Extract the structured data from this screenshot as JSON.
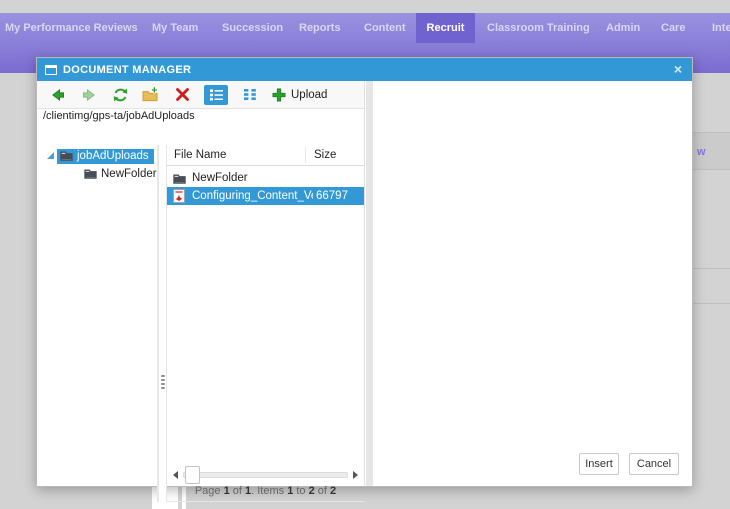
{
  "nav": {
    "items": [
      {
        "label": "My Performance Reviews",
        "active": false
      },
      {
        "label": "My Team",
        "active": false
      },
      {
        "label": "Succession",
        "active": false
      },
      {
        "label": "Reports",
        "active": false
      },
      {
        "label": "Content",
        "active": false
      },
      {
        "label": "Recruit",
        "active": true
      },
      {
        "label": "Classroom Training",
        "active": false
      },
      {
        "label": "Admin",
        "active": false
      },
      {
        "label": "Care",
        "active": false
      },
      {
        "label": "Inte",
        "active": false
      }
    ]
  },
  "page_background": {
    "truncated_link_text": "w"
  },
  "dialog": {
    "title": "DOCUMENT MANAGER",
    "icons": {
      "window": "window-icon",
      "close": "close-icon",
      "back": "back-arrow-icon",
      "forward": "forward-arrow-icon",
      "refresh": "refresh-icon",
      "new_folder": "new-folder-icon",
      "delete": "delete-icon",
      "list_view": "list-view-icon",
      "grid_view": "grid-view-icon",
      "upload": "upload-plus-icon",
      "folder": "folder-icon",
      "pdf": "pdf-file-icon"
    },
    "toolbar": {
      "upload_label": "Upload",
      "view_mode": "list"
    },
    "path_bar": {
      "value": "/clientimg/gps-ta/jobAdUploads"
    },
    "tree": {
      "items": [
        {
          "label": "jobAdUploads",
          "selected": true,
          "expanded": true
        },
        {
          "label": "NewFolder",
          "selected": false,
          "expanded": false
        }
      ]
    },
    "files": {
      "columns": [
        {
          "label": "File Name"
        },
        {
          "label": "Size"
        }
      ],
      "rows": [
        {
          "name": "NewFolder",
          "size": "",
          "icon": "folder",
          "selected": false
        },
        {
          "name": "Configuring_Content_Vendo",
          "size": "66797",
          "icon": "pdf",
          "selected": true
        }
      ],
      "pager_segments": [
        "Page ",
        "1",
        " of ",
        "1",
        ". Items ",
        "1",
        " to ",
        "2",
        " of ",
        "2"
      ]
    },
    "footer": {
      "insert_label": "Insert",
      "cancel_label": "Cancel"
    }
  },
  "colors": {
    "accent_blue": "#3399d6",
    "selection_blue": "#3399d6",
    "nav_purple_top": "#9a92e0",
    "nav_purple_bottom": "#7b6cd1",
    "nav_active_purple": "#7163cf",
    "page_gray": "#d3d3d3",
    "toolbar_gray": "#f8f8f8",
    "green_icon": "#2da12d",
    "red_icon": "#d11a1a"
  }
}
